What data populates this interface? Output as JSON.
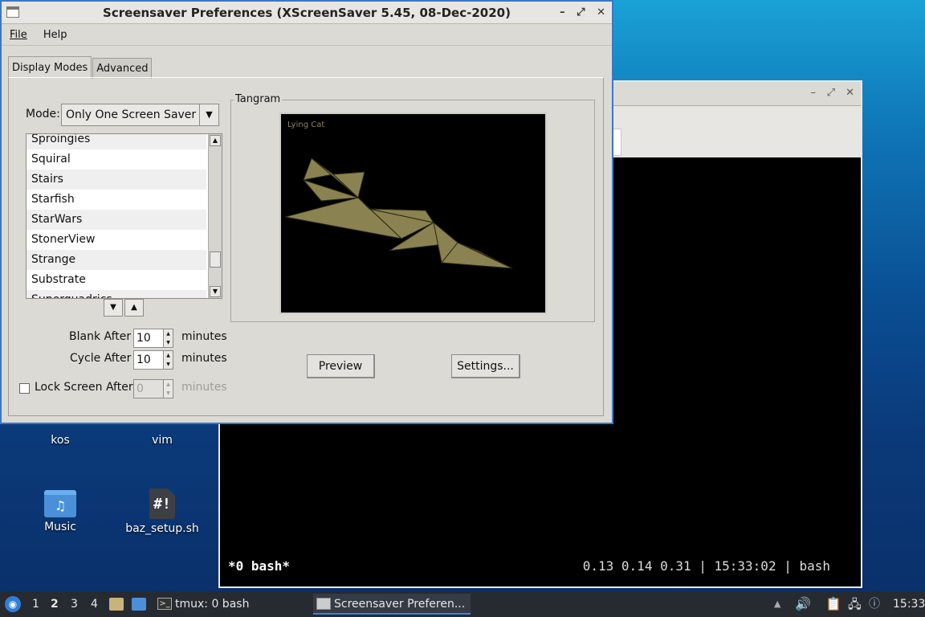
{
  "desktop": {
    "icons": [
      {
        "label": "kos"
      },
      {
        "label": "vim"
      },
      {
        "label": "Music",
        "glyph": "♫"
      },
      {
        "label": "baz_setup.sh",
        "glyph": "#!"
      }
    ]
  },
  "terminal": {
    "status_left": "*0 bash*",
    "status_right": "0.13 0.14 0.31 | 15:33:02 | bash"
  },
  "dialog": {
    "title": "Screensaver Preferences  (XScreenSaver 5.45, 08-Dec-2020)",
    "menu": {
      "file": "File",
      "help": "Help"
    },
    "tabs": {
      "display_modes": "Display Modes",
      "advanced": "Advanced"
    },
    "mode_label": "Mode:",
    "mode_value": "Only One Screen Saver",
    "list_items": [
      "Sproingies",
      "Squiral",
      "Stairs",
      "Starfish",
      "StarWars",
      "StonerView",
      "Strange",
      "Substrate",
      "Superquadrics"
    ],
    "blank_after_label": "Blank After",
    "blank_after_value": "10",
    "cycle_after_label": "Cycle After",
    "cycle_after_value": "10",
    "lock_label": "Lock Screen After",
    "lock_value": "0",
    "minutes": "minutes",
    "frame_title": "Tangram",
    "preview_caption": "Lying Cat",
    "preview_button": "Preview",
    "settings_button": "Settings..."
  },
  "taskbar": {
    "workspaces": [
      "1",
      "2",
      "3",
      "4"
    ],
    "active_workspace": "2",
    "tasks": [
      {
        "label": "tmux: 0 bash"
      },
      {
        "label": "Screensaver Preferen..."
      }
    ],
    "clock": "15:33"
  },
  "colors": {
    "dialog_border": "#3a78c8",
    "tangram_fill": "#8a8250",
    "taskbar_bg": "#262a31"
  }
}
